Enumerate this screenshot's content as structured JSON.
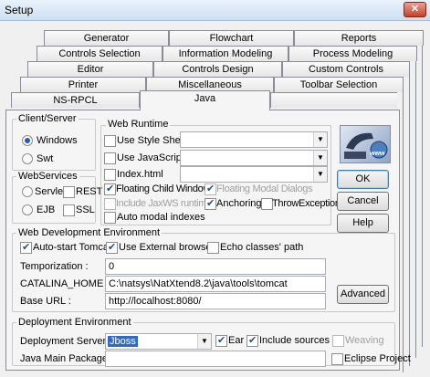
{
  "window": {
    "title": "Setup",
    "close_label": "✕"
  },
  "tabs": {
    "row1": [
      "Generator",
      "Flowchart",
      "Reports"
    ],
    "row2": [
      "Controls Selection",
      "Information Modeling",
      "Process Modeling"
    ],
    "row3": [
      "Editor",
      "Controls Design",
      "Custom Controls"
    ],
    "row4": [
      "Printer",
      "Miscellaneous",
      "Toolbar Selection"
    ],
    "row5": [
      "NS-RPCL",
      "Java"
    ],
    "selected": "Java"
  },
  "client_server": {
    "title": "Client/Server",
    "windows": "Windows",
    "swt": "Swt",
    "selected": "Windows"
  },
  "web_services": {
    "title": "WebServices",
    "servlet": "Servlet",
    "rest": "REST",
    "ejb": "EJB",
    "ssl": "SSL"
  },
  "web_runtime": {
    "title": "Web Runtime",
    "use_style_sheet": "Use Style Sheet",
    "use_javascript": "Use JavaScript",
    "index_html": "Index.html",
    "floating_child": "Floating Child Windows",
    "floating_modal": "Floating Modal Dialogs",
    "include_jaxws": "Include JaxWS runtime",
    "anchoring": "Anchoring",
    "throw_exception": "ThrowException",
    "auto_modal": "Auto modal indexes"
  },
  "buttons": {
    "ok": "OK",
    "cancel": "Cancel",
    "help": "Help",
    "advanced": "Advanced"
  },
  "logo_text": "www",
  "web_dev": {
    "title": "Web Development Environment",
    "auto_start": "Auto-start Tomcat",
    "use_external": "Use External browser",
    "echo_classes": "Echo classes' path",
    "temporization_label": "Temporization :",
    "temporization_value": "0",
    "catalina_label": "CATALINA_HOME :",
    "catalina_value": "C:\\natsys\\NatXtend8.2\\java\\tools\\tomcat",
    "base_url_label": "Base URL :",
    "base_url_value": "http://localhost:8080/"
  },
  "deploy": {
    "title": "Deployment Environment",
    "server_label": "Deployment Server :",
    "server_value": "Jboss",
    "ear": "Ear",
    "include_sources": "Include sources",
    "weaving": "Weaving",
    "java_main_label": "Java Main Package :",
    "java_main_value": "",
    "eclipse": "Eclipse Project"
  }
}
